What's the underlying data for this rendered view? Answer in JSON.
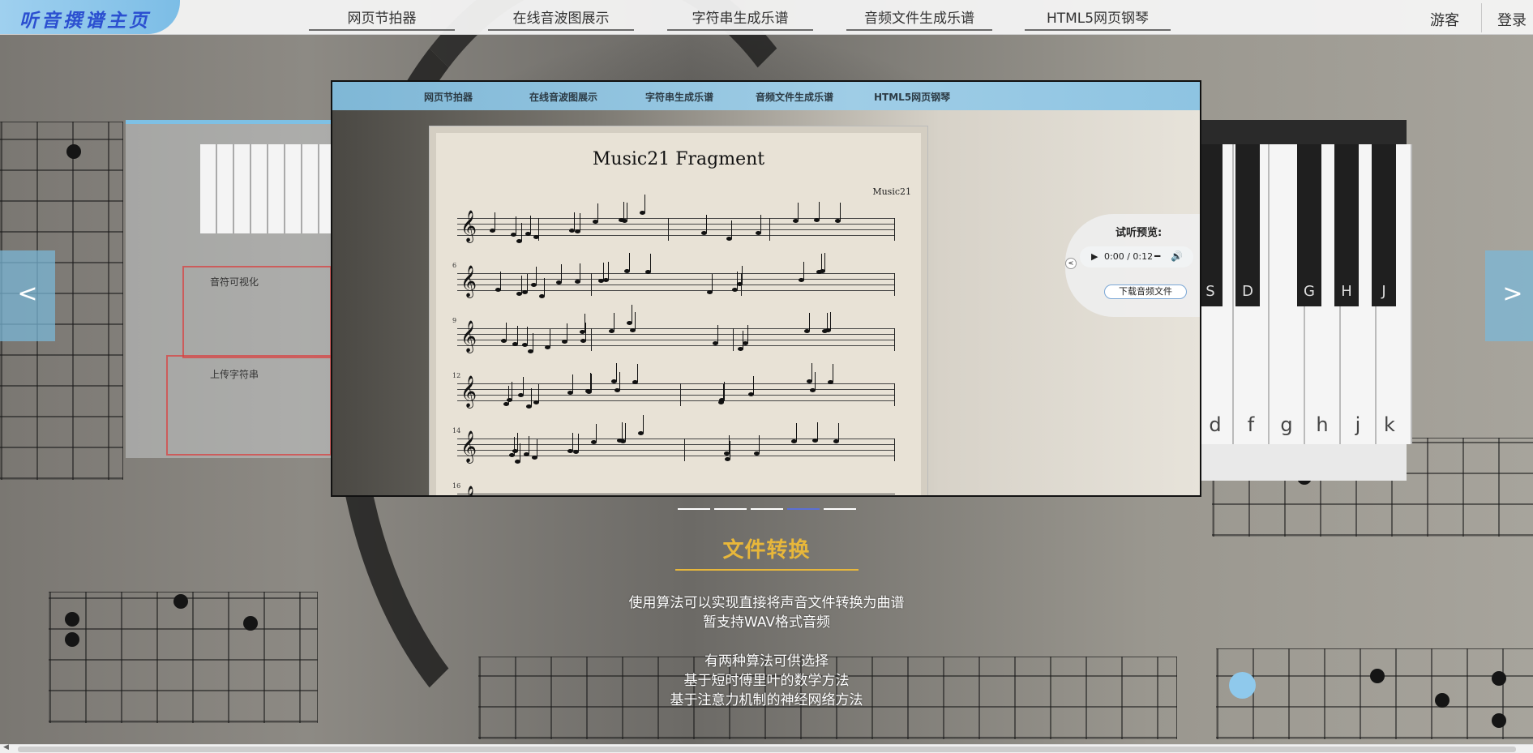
{
  "header": {
    "logo_text": "听音撰谱主页",
    "nav": [
      "网页节拍器",
      "在线音波图展示",
      "字符串生成乐谱",
      "音频文件生成乐谱",
      "HTML5网页钢琴"
    ],
    "user": "游客",
    "login": "登录"
  },
  "carousel": {
    "prev": "<",
    "next": ">",
    "slide_nav": [
      "网页节拍器",
      "在线音波图展示",
      "字符串生成乐谱",
      "音频文件生成乐谱",
      "HTML5网页钢琴"
    ],
    "sheet": {
      "title": "Music21 Fragment",
      "composer": "Music21",
      "measure_numbers": [
        "6",
        "9",
        "12",
        "14",
        "16"
      ]
    },
    "preview": {
      "title": "试听预览:",
      "time": "0:00 / 0:12",
      "download": "下载音频文件",
      "collapse": "<"
    },
    "indicator_count": 5,
    "active_indicator": 4
  },
  "left_panel": {
    "label1": "音符可视化",
    "label2": "上传字符串"
  },
  "right_panel": {
    "black_key_labels": [
      "S",
      "D",
      "G",
      "H",
      "J"
    ],
    "white_key_letters": [
      "d",
      "f",
      "g",
      "h",
      "j",
      "k"
    ]
  },
  "caption": {
    "title": "文件转换",
    "lines": [
      "使用算法可以实现直接将声音文件转换为曲谱",
      "暂支持WAV格式音频",
      "",
      "有两种算法可供选择",
      "基于短时傅里叶的数学方法",
      "基于注意力机制的神经网络方法"
    ]
  },
  "colors": {
    "accent_blue": "#8fc9ec",
    "caption_gold": "#e8b73a",
    "active_indicator": "#5b6fd6"
  }
}
